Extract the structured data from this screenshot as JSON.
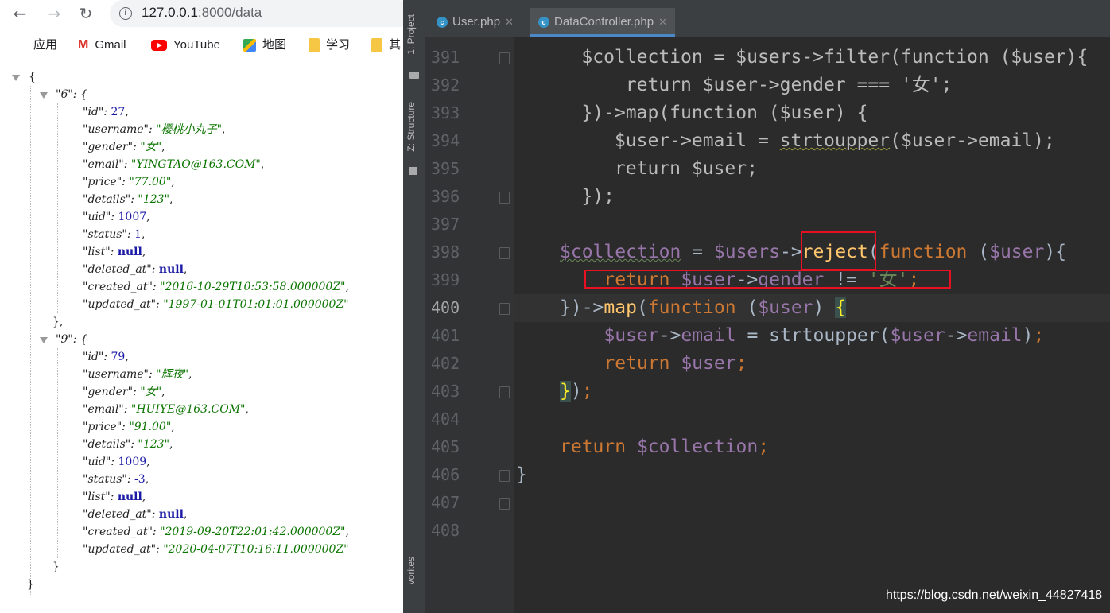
{
  "browser": {
    "nav": {
      "back_icon": "arrow-left-icon",
      "forward_icon": "arrow-right-icon",
      "reload_icon": "reload-icon"
    },
    "address": {
      "host": "127.0.0.1",
      "rest": ":8000/data"
    },
    "bookmarks": [
      {
        "label": "应用",
        "icon": "apps-grid-icon"
      },
      {
        "label": "Gmail",
        "icon": "gmail-icon"
      },
      {
        "label": "YouTube",
        "icon": "youtube-icon"
      },
      {
        "label": "地图",
        "icon": "maps-icon"
      },
      {
        "label": "学习",
        "icon": "folder-icon"
      },
      {
        "label": "其",
        "icon": "folder-icon"
      }
    ],
    "json": {
      "open_brace": "{",
      "close_brace": "}",
      "records": [
        {
          "key": "\"6\":  {",
          "fields": [
            {
              "k": "\"id\":",
              "v": "27",
              "t": "num"
            },
            {
              "k": "\"username\":",
              "v": "\"樱桃小丸子\"",
              "t": "str"
            },
            {
              "k": "\"gender\":",
              "v": "\"女\"",
              "t": "str"
            },
            {
              "k": "\"email\":",
              "v": "\"YINGTAO@163.COM\"",
              "t": "str"
            },
            {
              "k": "\"price\":",
              "v": "\"77.00\"",
              "t": "str"
            },
            {
              "k": "\"details\":",
              "v": "\"123\"",
              "t": "str"
            },
            {
              "k": "\"uid\":",
              "v": "1007",
              "t": "num"
            },
            {
              "k": "\"status\":",
              "v": "1",
              "t": "num"
            },
            {
              "k": "\"list\":",
              "v": "null",
              "t": "nul"
            },
            {
              "k": "\"deleted_at\":",
              "v": "null",
              "t": "nul"
            },
            {
              "k": "\"created_at\":",
              "v": "\"2016-10-29T10:53:58.000000Z\"",
              "t": "str"
            },
            {
              "k": "\"updated_at\":",
              "v": "\"1997-01-01T01:01:01.000000Z\"",
              "t": "str"
            }
          ],
          "close": "},"
        },
        {
          "key": "\"9\":  {",
          "fields": [
            {
              "k": "\"id\":",
              "v": "79",
              "t": "num"
            },
            {
              "k": "\"username\":",
              "v": "\"辉夜\"",
              "t": "str"
            },
            {
              "k": "\"gender\":",
              "v": "\"女\"",
              "t": "str"
            },
            {
              "k": "\"email\":",
              "v": "\"HUIYE@163.COM\"",
              "t": "str"
            },
            {
              "k": "\"price\":",
              "v": "\"91.00\"",
              "t": "str"
            },
            {
              "k": "\"details\":",
              "v": "\"123\"",
              "t": "str"
            },
            {
              "k": "\"uid\":",
              "v": "1009",
              "t": "num"
            },
            {
              "k": "\"status\":",
              "v": "-3",
              "t": "num"
            },
            {
              "k": "\"list\":",
              "v": "null",
              "t": "nul"
            },
            {
              "k": "\"deleted_at\":",
              "v": "null",
              "t": "nul"
            },
            {
              "k": "\"created_at\":",
              "v": "\"2019-09-20T22:01:42.000000Z\"",
              "t": "str"
            },
            {
              "k": "\"updated_at\":",
              "v": "\"2020-04-07T10:16:11.000000Z\"",
              "t": "str"
            }
          ],
          "close": "}"
        }
      ]
    }
  },
  "ide": {
    "side_tabs": [
      "1: Project",
      "Z: Structure",
      "vorites"
    ],
    "tabs": [
      {
        "label": "User.php",
        "active": false
      },
      {
        "label": "DataController.php",
        "active": true
      }
    ],
    "current_line": "400",
    "lines": [
      {
        "n": "391",
        "segs": [
          [
            "dim",
            "    $collection = $users->filter(function ($user){"
          ]
        ]
      },
      {
        "n": "392",
        "segs": [
          [
            "dim",
            "        return $user->gender === '女';"
          ]
        ]
      },
      {
        "n": "393",
        "segs": [
          [
            "dim",
            "    })->map(function ($user) {"
          ]
        ]
      },
      {
        "n": "394",
        "segs": [
          [
            "dim",
            "       $user->email = "
          ],
          [
            "dimsq",
            "strtoupper"
          ],
          [
            "dim",
            "($user->email);"
          ]
        ]
      },
      {
        "n": "395",
        "segs": [
          [
            "dim",
            "       return $user;"
          ]
        ]
      },
      {
        "n": "396",
        "segs": [
          [
            "dim",
            "    });"
          ]
        ]
      },
      {
        "n": "397",
        "segs": []
      },
      {
        "n": "398",
        "segs": [
          [
            "vrsq",
            "$collection"
          ],
          [
            "plain",
            " = "
          ],
          [
            "vr",
            "$users"
          ],
          [
            "plain",
            "->"
          ],
          [
            "fn",
            "reject"
          ],
          [
            "plain",
            "("
          ],
          [
            "kw",
            "function "
          ],
          [
            "plain",
            "("
          ],
          [
            "vr",
            "$user"
          ],
          [
            "plain",
            "){"
          ]
        ]
      },
      {
        "n": "399",
        "segs": [
          [
            "plain",
            "    "
          ],
          [
            "kw",
            "return "
          ],
          [
            "vr",
            "$user"
          ],
          [
            "plain",
            "->"
          ],
          [
            "vr",
            "gender"
          ],
          [
            "plain",
            " != "
          ],
          [
            "sq",
            "'女'"
          ],
          [
            "kw",
            ";"
          ]
        ]
      },
      {
        "n": "400",
        "segs": [
          [
            "plain",
            "})->"
          ],
          [
            "fn",
            "map"
          ],
          [
            "plain",
            "("
          ],
          [
            "kw",
            "function "
          ],
          [
            "plain",
            "("
          ],
          [
            "vr",
            "$user"
          ],
          [
            "plain",
            ") "
          ],
          [
            "hl",
            "{"
          ]
        ]
      },
      {
        "n": "401",
        "segs": [
          [
            "plain",
            "    "
          ],
          [
            "vr",
            "$user"
          ],
          [
            "plain",
            "->"
          ],
          [
            "vr",
            "email"
          ],
          [
            "plain",
            " = strtoupper("
          ],
          [
            "vr",
            "$user"
          ],
          [
            "plain",
            "->"
          ],
          [
            "vr",
            "email"
          ],
          [
            "plain",
            ")"
          ],
          [
            "kw",
            ";"
          ]
        ]
      },
      {
        "n": "402",
        "segs": [
          [
            "plain",
            "    "
          ],
          [
            "kw",
            "return "
          ],
          [
            "vr",
            "$user"
          ],
          [
            "kw",
            ";"
          ]
        ]
      },
      {
        "n": "403",
        "segs": [
          [
            "hl",
            "}"
          ],
          [
            "plain",
            ")"
          ],
          [
            "kw",
            ";"
          ]
        ]
      },
      {
        "n": "404",
        "segs": []
      },
      {
        "n": "405",
        "segs": [
          [
            "kw",
            "return "
          ],
          [
            "vr",
            "$collection"
          ],
          [
            "kw",
            ";"
          ]
        ]
      },
      {
        "n": "406",
        "segs": [
          [
            "plain",
            "}"
          ]
        ]
      },
      {
        "n": "407",
        "segs": []
      },
      {
        "n": "408",
        "segs": []
      }
    ],
    "watermark": "https://blog.csdn.net/weixin_44827418"
  }
}
